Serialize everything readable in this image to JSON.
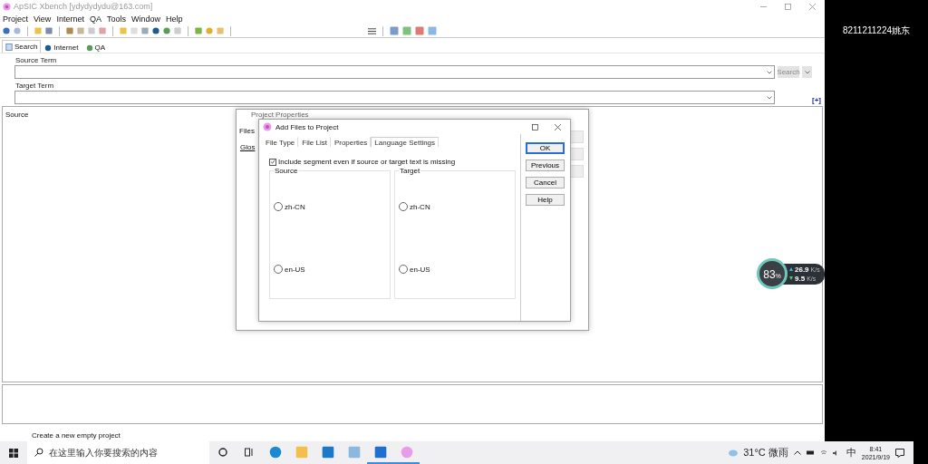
{
  "window": {
    "title": "ApSIC Xbench [ydydydydu@163.com]"
  },
  "menu": [
    "Project",
    "View",
    "Internet",
    "QA",
    "Tools",
    "Window",
    "Help"
  ],
  "search_tabs": [
    {
      "label": "Search",
      "selected": true
    },
    {
      "label": "Internet",
      "selected": false
    },
    {
      "label": "QA",
      "selected": false
    }
  ],
  "source_term": {
    "label": "Source Term"
  },
  "search_button": "Search",
  "target_term": {
    "label": "Target Term"
  },
  "expand_link": "[+]",
  "results": {
    "column_1": "Source"
  },
  "status_bar": "Create a new empty project",
  "project_properties": {
    "title": "Project Properties",
    "tab": "Files",
    "section": "Glos"
  },
  "add_files_dialog": {
    "title": "Add Files to Project",
    "tabs": [
      {
        "label": "File Type",
        "selected": false
      },
      {
        "label": "File List",
        "selected": false
      },
      {
        "label": "Properties",
        "selected": false
      },
      {
        "label": "Language Settings",
        "selected": true
      }
    ],
    "include_missing": {
      "label": "Include segment even if source or target text is missing",
      "checked": true
    },
    "groups": [
      {
        "label": "Source",
        "options": [
          {
            "label": "zh-CN",
            "selected": false
          },
          {
            "label": "en-US",
            "selected": false
          }
        ]
      },
      {
        "label": "Target",
        "options": [
          {
            "label": "zh-CN",
            "selected": false
          },
          {
            "label": "en-US",
            "selected": false
          }
        ]
      }
    ],
    "buttons": [
      {
        "label": "OK",
        "default": true
      },
      {
        "label": "Previous",
        "default": false
      },
      {
        "label": "Cancel",
        "default": false
      },
      {
        "label": "Help",
        "default": false
      }
    ]
  },
  "network_widget": {
    "percent": "83",
    "unit": "%",
    "upload": "26.9",
    "upload_unit": "K/s",
    "download": "9.5",
    "download_unit": "K/s"
  },
  "overlay_text": "8211211224姚东",
  "taskbar": {
    "search_placeholder": "在这里输入你要搜索的内容",
    "weather": "31°C 微雨",
    "ime": "中",
    "time": "8:41",
    "date": "2021/9/19"
  }
}
